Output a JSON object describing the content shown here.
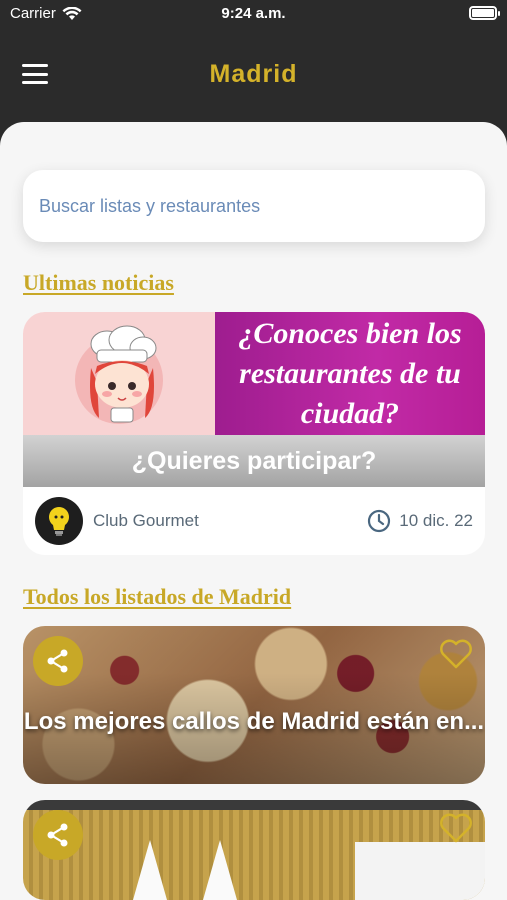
{
  "status": {
    "carrier": "Carrier",
    "time": "9:24 a.m."
  },
  "header": {
    "title": "Madrid",
    "menu_icon": "hamburger-icon"
  },
  "search": {
    "placeholder": "Buscar listas y restaurantes"
  },
  "news": {
    "section_title": "Ultimas noticias",
    "banner_text": "¿Conoces bien los restaurantes de tu ciudad?",
    "subtitle": "¿Quieres participar?",
    "author": "Club Gourmet",
    "date": "10 dic. 22"
  },
  "listings": {
    "section_title": "Todos los listados de Madrid",
    "items": [
      {
        "title": "Los mejores callos de Madrid están en..."
      },
      {
        "title": ""
      }
    ]
  },
  "colors": {
    "accent": "#c8a827",
    "nav_bg": "#2b2b2b",
    "banner_magenta": "#b61e96"
  }
}
